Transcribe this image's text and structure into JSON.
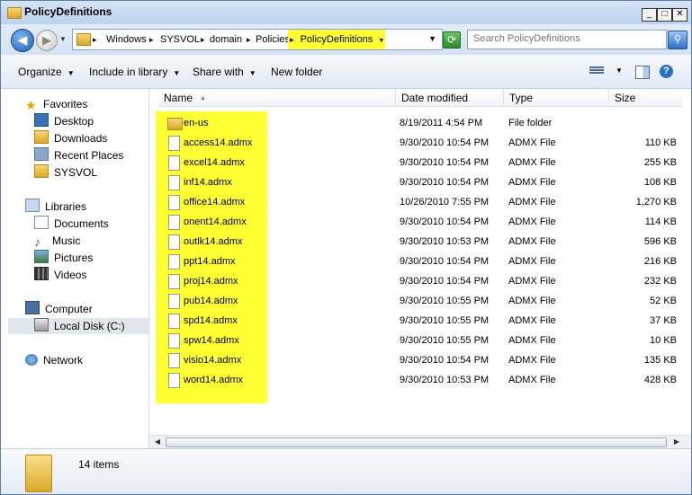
{
  "window": {
    "title": "PolicyDefinitions"
  },
  "titlebar_buttons": {
    "minimize": "_",
    "maximize": "□",
    "close": "✕"
  },
  "address": {
    "crumbs": [
      "Windows",
      "SYSVOL",
      "domain",
      "Policies",
      "PolicyDefinitions"
    ],
    "separator": "▸",
    "highlighted_crumb": "PolicyDefinitions"
  },
  "search": {
    "placeholder": "Search PolicyDefinitions"
  },
  "toolbar": {
    "organize": "Organize",
    "include_in_library": "Include in library",
    "share_with": "Share with",
    "new_folder": "New folder"
  },
  "nav": {
    "favorites": "Favorites",
    "desktop": "Desktop",
    "downloads": "Downloads",
    "recent_places": "Recent Places",
    "sysvol": "SYSVOL",
    "libraries": "Libraries",
    "documents": "Documents",
    "music": "Music",
    "pictures": "Pictures",
    "videos": "Videos",
    "computer": "Computer",
    "local_disk": "Local Disk (C:)",
    "network": "Network"
  },
  "columns": {
    "name": "Name",
    "date": "Date modified",
    "type": "Type",
    "size": "Size"
  },
  "files": [
    {
      "name": "en-us",
      "date": "8/19/2011 4:54 PM",
      "type": "File folder",
      "size": "",
      "kind": "folder"
    },
    {
      "name": "access14.admx",
      "date": "9/30/2010 10:54 PM",
      "type": "ADMX File",
      "size": "110 KB",
      "kind": "file"
    },
    {
      "name": "excel14.admx",
      "date": "9/30/2010 10:54 PM",
      "type": "ADMX File",
      "size": "255 KB",
      "kind": "file"
    },
    {
      "name": "inf14.admx",
      "date": "9/30/2010 10:54 PM",
      "type": "ADMX File",
      "size": "108 KB",
      "kind": "file"
    },
    {
      "name": "office14.admx",
      "date": "10/26/2010 7:55 PM",
      "type": "ADMX File",
      "size": "1,270 KB",
      "kind": "file"
    },
    {
      "name": "onent14.admx",
      "date": "9/30/2010 10:54 PM",
      "type": "ADMX File",
      "size": "114 KB",
      "kind": "file"
    },
    {
      "name": "outlk14.admx",
      "date": "9/30/2010 10:53 PM",
      "type": "ADMX File",
      "size": "596 KB",
      "kind": "file"
    },
    {
      "name": "ppt14.admx",
      "date": "9/30/2010 10:54 PM",
      "type": "ADMX File",
      "size": "216 KB",
      "kind": "file"
    },
    {
      "name": "proj14.admx",
      "date": "9/30/2010 10:54 PM",
      "type": "ADMX File",
      "size": "232 KB",
      "kind": "file"
    },
    {
      "name": "pub14.admx",
      "date": "9/30/2010 10:55 PM",
      "type": "ADMX File",
      "size": "52 KB",
      "kind": "file"
    },
    {
      "name": "spd14.admx",
      "date": "9/30/2010 10:55 PM",
      "type": "ADMX File",
      "size": "37 KB",
      "kind": "file"
    },
    {
      "name": "spw14.admx",
      "date": "9/30/2010 10:55 PM",
      "type": "ADMX File",
      "size": "10 KB",
      "kind": "file"
    },
    {
      "name": "visio14.admx",
      "date": "9/30/2010 10:54 PM",
      "type": "ADMX File",
      "size": "135 KB",
      "kind": "file"
    },
    {
      "name": "word14.admx",
      "date": "9/30/2010 10:53 PM",
      "type": "ADMX File",
      "size": "428 KB",
      "kind": "file"
    }
  ],
  "status": {
    "item_count": "14 items"
  },
  "colors": {
    "highlight": "#ffff33",
    "titlebar": "#c9dbf2",
    "selection": "#dfe6ee"
  }
}
